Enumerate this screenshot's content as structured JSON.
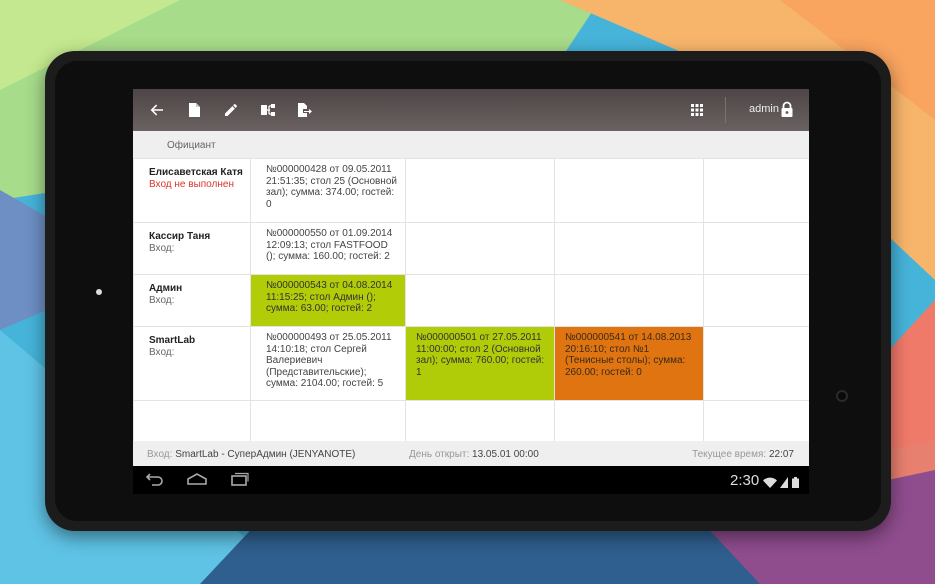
{
  "theme": {
    "appbar_color": "#5a5152",
    "green": "#b2cc08",
    "orange": "#df7410",
    "error_red": "#d9362b"
  },
  "toolbar": {
    "icons": [
      "back-arrow-icon",
      "new-document-icon",
      "edit-pencil-icon",
      "transfer-icon",
      "export-icon",
      "grid-apps-icon",
      "lock-icon"
    ],
    "user": "admin"
  },
  "subheader": {
    "column_label": "Официант"
  },
  "waiters": [
    {
      "name": "Елисаветская Катя",
      "status": "Вход не выполнен",
      "orders": [
        {
          "text": "№000000428 от 09.05.2011 21:51:35; стол 25 (Основной зал); сумма: 374.00; гостей: 0"
        }
      ]
    },
    {
      "name": "Кассир Таня",
      "status": "Вход:",
      "orders": [
        {
          "text": "№000000550 от 01.09.2014 12:09:13; стол FASTFOOD (); сумма: 160.00; гостей: 2"
        }
      ]
    },
    {
      "name": "Админ",
      "status": "Вход:",
      "orders": [
        {
          "text": "№000000543 от 04.08.2014 11:15:25; стол Админ (); сумма: 63.00; гостей: 2"
        }
      ]
    },
    {
      "name": "SmartLab",
      "status": "Вход:",
      "orders": [
        {
          "text": "№000000493 от 25.05.2011 14:10:18; стол Сергей Валериевич (Представительские); сумма: 2104.00; гостей: 5"
        },
        {
          "text": "№000000501 от 27.05.2011 11:00:00; стол 2 (Основной зал); сумма: 760.00; гостей: 1"
        },
        {
          "text": "№000000541 от 14.08.2013 20:16:10; стол №1 (Тенисные столы); сумма: 260.00; гостей: 0"
        }
      ]
    }
  ],
  "statusbar": {
    "login_label": "Вход:",
    "login_value": "SmartLab - СуперАдмин (JENYANOTE)",
    "day_label": "День открыт:",
    "day_value": "13.05.01 00:00",
    "time_label": "Текущее время:",
    "time_value": "22:07"
  },
  "android": {
    "clock": "2:30",
    "nav_icons": [
      "back-nav-icon",
      "home-nav-icon",
      "recents-nav-icon"
    ],
    "status_icons": [
      "wifi-icon",
      "battery-icon"
    ]
  }
}
